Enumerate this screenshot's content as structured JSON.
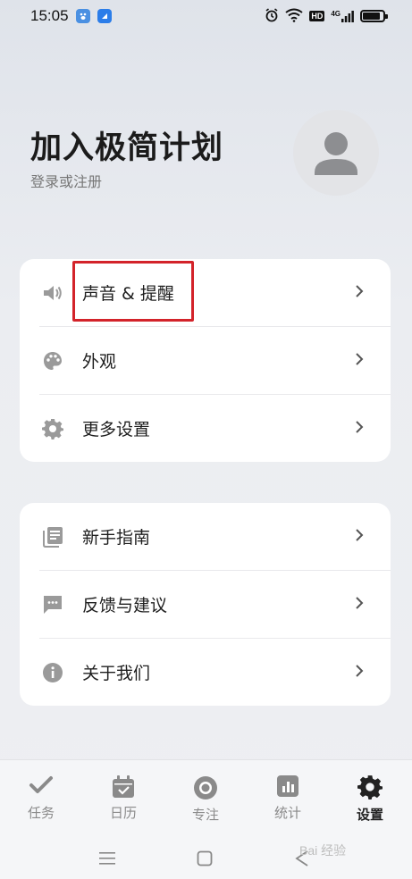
{
  "status_bar": {
    "time": "15:05",
    "network": "4G",
    "hd_badge": "HD",
    "battery_level": 0.85,
    "icons": [
      "baidu-paw-icon",
      "app-icon",
      "alarm-icon",
      "wifi-icon",
      "hd-icon",
      "signal-icon",
      "battery-icon"
    ]
  },
  "profile": {
    "title": "加入极简计划",
    "subtitle": "登录或注册",
    "avatar_icon": "user-avatar-icon"
  },
  "settings_group_1": {
    "items": [
      {
        "label": "声音 & 提醒",
        "icon": "volume-icon"
      },
      {
        "label": "外观",
        "icon": "palette-icon"
      },
      {
        "label": "更多设置",
        "icon": "gear-icon"
      }
    ]
  },
  "settings_group_2": {
    "items": [
      {
        "label": "新手指南",
        "icon": "guide-book-icon"
      },
      {
        "label": "反馈与建议",
        "icon": "feedback-icon"
      },
      {
        "label": "关于我们",
        "icon": "info-icon"
      }
    ]
  },
  "tabbar": {
    "tabs": [
      {
        "label": "任务",
        "icon": "check-icon",
        "active": false
      },
      {
        "label": "日历",
        "icon": "calendar-icon",
        "active": false
      },
      {
        "label": "专注",
        "icon": "focus-icon",
        "active": false
      },
      {
        "label": "统计",
        "icon": "stats-icon",
        "active": false
      },
      {
        "label": "设置",
        "icon": "gear-icon",
        "active": true
      }
    ]
  },
  "navbar": {
    "icons": [
      "menu-icon",
      "home-icon",
      "back-icon"
    ]
  },
  "watermark": {
    "text": "Bai 经验"
  },
  "colors": {
    "highlight_border": "#d3232a",
    "icon_gray": "#9a9a9a",
    "active_tab": "#222222"
  }
}
